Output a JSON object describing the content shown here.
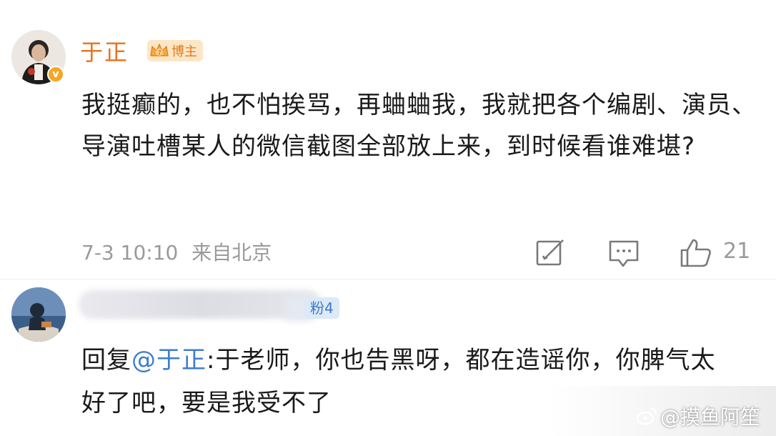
{
  "post": {
    "author_name": "于正",
    "author_badge": "博主",
    "verified_mark": "v",
    "text": "我挺癫的，也不怕挨骂，再蛐蛐我，我就把各个编剧、演员、导演吐槽某人的微信截图全部放上来，到时候看谁难堪?",
    "timestamp": "7-3 10:10",
    "location": "来自北京",
    "actions": {
      "repost_icon": "repost-icon",
      "comment_icon": "comment-icon",
      "like_icon": "like-icon",
      "like_count": "21"
    }
  },
  "reply": {
    "fan_badge": "粉4",
    "prefix": "回复",
    "mention": "@于正",
    "text": ":于老师，你也告黑呀，都在造谣你，你脾气太好了吧，要是我受不了"
  },
  "watermark": {
    "text": "@摸鱼阿笙"
  },
  "colors": {
    "author_name": "#e8721d",
    "mention": "#3e7dcf",
    "meta": "#9a9a9a",
    "badge_bg": "#fde6c6",
    "fan_badge_bg": "#dce9f7"
  }
}
